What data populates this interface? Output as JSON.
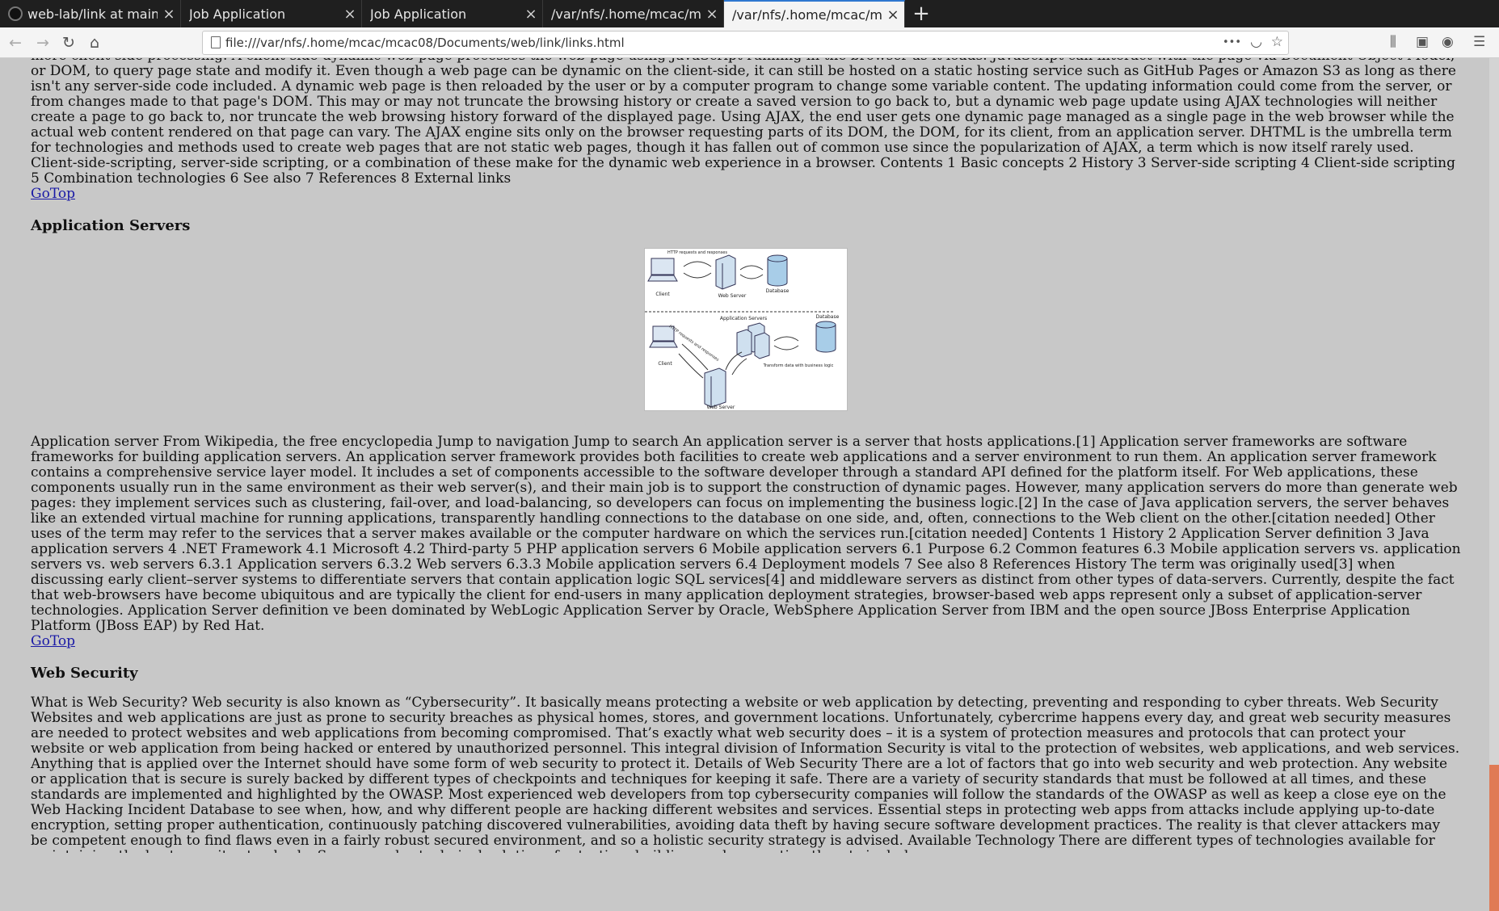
{
  "tabs": [
    {
      "label": "web-lab/link at main · acl",
      "close": "×"
    },
    {
      "label": "Job Application",
      "close": "×"
    },
    {
      "label": "Job Application",
      "close": "×"
    },
    {
      "label": "/var/nfs/.home/mcac/mcac",
      "close": "×"
    },
    {
      "label": "/var/nfs/.home/mcac/mcac",
      "close": "×"
    }
  ],
  "new_tab": "+",
  "nav": {
    "back": "←",
    "forward": "→",
    "reload": "↻",
    "home": "⌂",
    "url": "file:///var/nfs/.home/mcac/mcac08/Documents/web/link/links.html",
    "more": "•••",
    "pocket": "◡",
    "bookmark": "☆",
    "library": "⫼",
    "sidebar": "▣",
    "account": "◉",
    "menu": "☰"
  },
  "content": {
    "para_top": "more client-side processing. A client-side dynamic web page processes the web page using JavaScript running in the browser as it loads. JavaScript can interact with the page via Document Object Model, or DOM, to query page state and modify it. Even though a web page can be dynamic on the client-side, it can still be hosted on a static hosting service such as GitHub Pages or Amazon S3 as long as there isn't any server-side code included. A dynamic web page is then reloaded by the user or by a computer program to change some variable content. The updating information could come from the server, or from changes made to that page's DOM. This may or may not truncate the browsing history or create a saved version to go back to, but a dynamic web page update using AJAX technologies will neither create a page to go back to, nor truncate the web browsing history forward of the displayed page. Using AJAX, the end user gets one dynamic page managed as a single page in the web browser while the actual web content rendered on that page can vary. The AJAX engine sits only on the browser requesting parts of its DOM, the DOM, for its client, from an application server. DHTML is the umbrella term for technologies and methods used to create web pages that are not static web pages, though it has fallen out of common use since the popularization of AJAX, a term which is now itself rarely used. Client-side-scripting, server-side scripting, or a combination of these make for the dynamic web experience in a browser. Contents 1 Basic concepts 2 History 3 Server-side scripting 4 Client-side scripting 5 Combination technologies 6 See also 7 References 8 External links",
    "goto_1": "GoTop",
    "heading_app_servers": "Application Servers",
    "diagram": {
      "http_label": "HTTP requests and responses",
      "client": "Client",
      "web_server": "Web Server",
      "database": "Database",
      "app_servers": "Application Servers",
      "database2": "Database",
      "client2": "Client",
      "http_label2": "HTTP requests and responses",
      "transform": "Transform data with business logic",
      "web_server2": "Web Server"
    },
    "para_app_servers": "Application server From Wikipedia, the free encyclopedia Jump to navigation Jump to search An application server is a server that hosts applications.[1] Application server frameworks are software frameworks for building application servers. An application server framework provides both facilities to create web applications and a server environment to run them. An application server framework contains a comprehensive service layer model. It includes a set of components accessible to the software developer through a standard API defined for the platform itself. For Web applications, these components usually run in the same environment as their web server(s), and their main job is to support the construction of dynamic pages. However, many application servers do more than generate web pages: they implement services such as clustering, fail-over, and load-balancing, so developers can focus on implementing the business logic.[2] In the case of Java application servers, the server behaves like an extended virtual machine for running applications, transparently handling connections to the database on one side, and, often, connections to the Web client on the other.[citation needed] Other uses of the term may refer to the services that a server makes available or the computer hardware on which the services run.[citation needed] Contents 1 History 2 Application Server definition 3 Java application servers 4 .NET Framework 4.1 Microsoft 4.2 Third-party 5 PHP application servers 6 Mobile application servers 6.1 Purpose 6.2 Common features 6.3 Mobile application servers vs. application servers vs. web servers 6.3.1 Application servers 6.3.2 Web servers 6.3.3 Mobile application servers 6.4 Deployment models 7 See also 8 References History The term was originally used[3] when discussing early client–server systems to differentiate servers that contain application logic SQL services[4] and middleware servers as distinct from other types of data-servers. Currently, despite the fact that web-browsers have become ubiquitous and are typically the client for end-users in many application deployment strategies, browser-based web apps represent only a subset of application-server technologies. Application Server definition ve been dominated by WebLogic Application Server by Oracle, WebSphere Application Server from IBM and the open source JBoss Enterprise Application Platform (JBoss EAP) by Red Hat.",
    "goto_2": "GoTop",
    "heading_web_security": "Web Security",
    "para_web_security": "What is Web Security? Web security is also known as “Cybersecurity”. It basically means protecting a website or web application by detecting, preventing and responding to cyber threats. Web Security Websites and web applications are just as prone to security breaches as physical homes, stores, and government locations. Unfortunately, cybercrime happens every day, and great web security measures are needed to protect websites and web applications from becoming compromised. That’s exactly what web security does – it is a system of protection measures and protocols that can protect your website or web application from being hacked or entered by unauthorized personnel. This integral division of Information Security is vital to the protection of websites, web applications, and web services. Anything that is applied over the Internet should have some form of web security to protect it. Details of Web Security There are a lot of factors that go into web security and web protection. Any website or application that is secure is surely backed by different types of checkpoints and techniques for keeping it safe. There are a variety of security standards that must be followed at all times, and these standards are implemented and highlighted by the OWASP. Most experienced web developers from top cybersecurity companies will follow the standards of the OWASP as well as keep a close eye on the Web Hacking Incident Database to see when, how, and why different people are hacking different websites and services. Essential steps in protecting web apps from attacks include applying up-to-date encryption, setting proper authentication, continuously patching discovered vulnerabilities, avoiding data theft by having secure software development practices. The reality is that clever attackers may be competent enough to find flaws even in a fairly robust secured environment, and so a holistic security strategy is advised. Available Technology There are different types of technologies available for maintaining the best security standards. Some popular technical solutions for testing, building, and preventing threats include:"
  }
}
